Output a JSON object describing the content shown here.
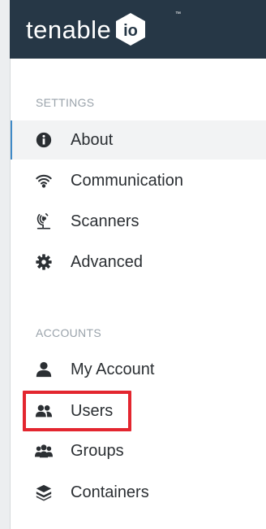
{
  "header": {
    "logo_text": "tenable",
    "logo_suffix": "io",
    "logo_tm": "™"
  },
  "sidebar": {
    "settings_title": "SETTINGS",
    "settings_items": [
      {
        "label": "About",
        "icon": "info-icon"
      },
      {
        "label": "Communication",
        "icon": "wifi-icon"
      },
      {
        "label": "Scanners",
        "icon": "radar-icon"
      },
      {
        "label": "Advanced",
        "icon": "gear-icon"
      }
    ],
    "accounts_title": "ACCOUNTS",
    "accounts_items": [
      {
        "label": "My Account",
        "icon": "user-icon"
      },
      {
        "label": "Users",
        "icon": "users-icon"
      },
      {
        "label": "Groups",
        "icon": "groups-icon"
      },
      {
        "label": "Containers",
        "icon": "containers-icon"
      }
    ]
  },
  "colors": {
    "header_bg": "#263746",
    "active_accent": "#3f8ac7",
    "highlight": "#e3262f",
    "text": "#2b2f33",
    "section_title": "#9aa3ab"
  }
}
